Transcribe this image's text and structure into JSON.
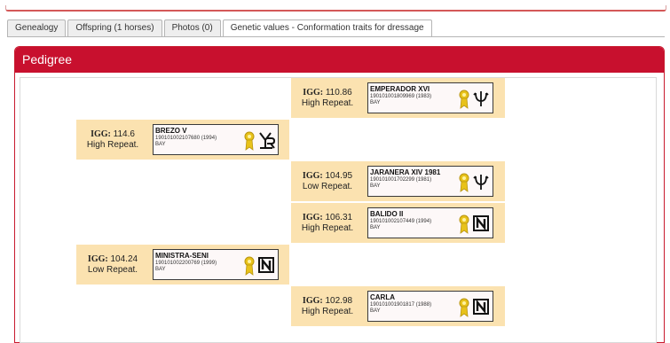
{
  "tabs": [
    {
      "label": "Genealogy"
    },
    {
      "label": "Offspring (1 horses)"
    },
    {
      "label": "Photos (0)"
    },
    {
      "label": "Genetic values - Conformation traits for dressage"
    }
  ],
  "panel": {
    "title": "Pedigree"
  },
  "igg_label": "IGG:",
  "horses": [
    {
      "name": "EMPERADOR XVI",
      "reg": "190101001809969 (1983)",
      "color": "BAY",
      "igg": "110.86",
      "repeat": "High Repeat.",
      "brand_icon": "trident-brand-icon"
    },
    {
      "name": "BREZO V",
      "reg": "190101002107680 (1994)",
      "color": "BAY",
      "igg": "114.6",
      "repeat": "High Repeat.",
      "brand_icon": "yr-brand-icon"
    },
    {
      "name": "JARANERA XIV 1981",
      "reg": "190101001702299 (1981)",
      "color": "BAY",
      "igg": "104.95",
      "repeat": "Low Repeat.",
      "brand_icon": "trident-brand-icon"
    },
    {
      "name": "BALIDO II",
      "reg": "190101002107449 (1994)",
      "color": "BAY",
      "igg": "106.31",
      "repeat": "High Repeat.",
      "brand_icon": "n-brand-icon"
    },
    {
      "name": "MINISTRA-SENI",
      "reg": "190101002200769 (1999)",
      "color": "BAY",
      "igg": "104.24",
      "repeat": "Low Repeat.",
      "brand_icon": "n-brand-icon"
    },
    {
      "name": "CARLA",
      "reg": "190101001901817 (1988)",
      "color": "BAY",
      "igg": "102.98",
      "repeat": "High Repeat.",
      "brand_icon": "n-brand-icon"
    }
  ],
  "colors": {
    "accent": "#c8102e",
    "entry_bg": "#fbe2b0",
    "ribbon": "#e8c21a"
  }
}
